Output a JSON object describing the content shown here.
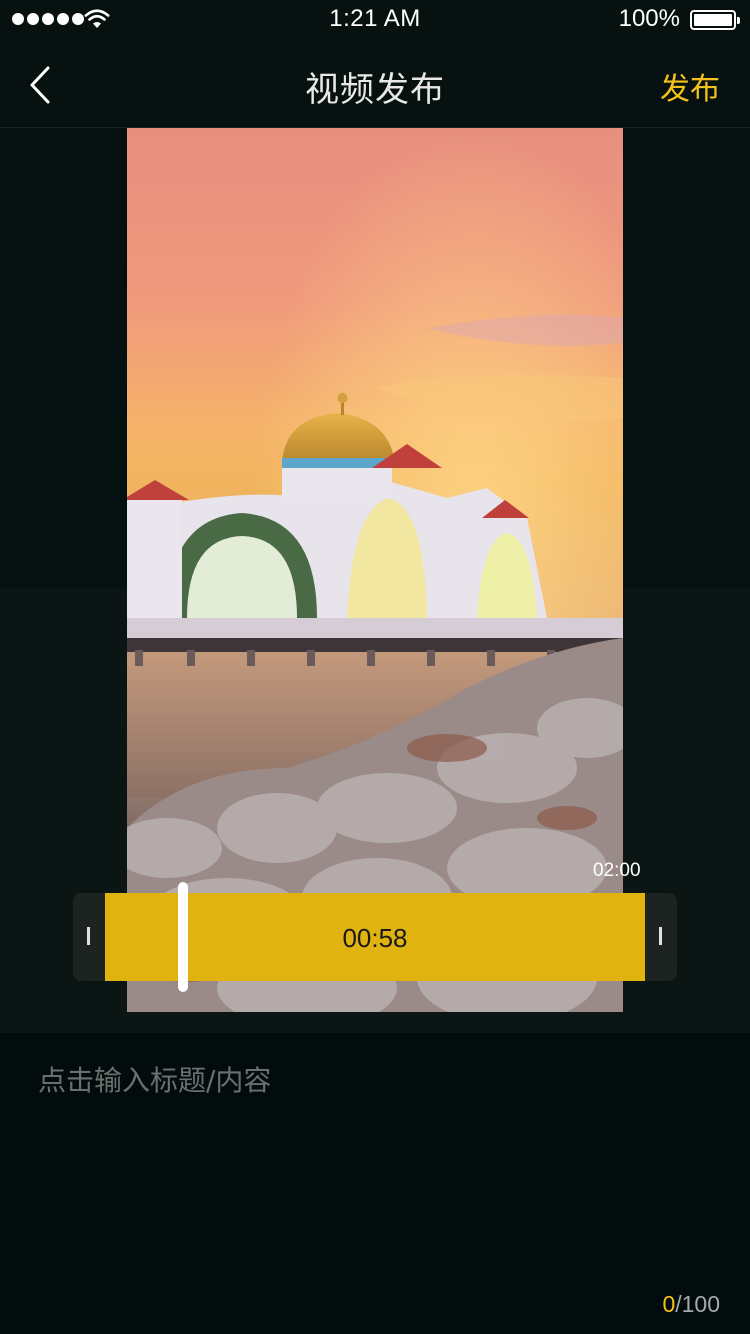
{
  "status_bar": {
    "time": "1:21 AM",
    "battery_percent": "100%",
    "icons": [
      "signal-dots-icon",
      "wifi-icon",
      "battery-icon"
    ]
  },
  "nav": {
    "title": "视频发布",
    "back_icon": "chevron-left-icon",
    "publish_label": "发布"
  },
  "video": {
    "total_duration": "02:00",
    "selected_duration": "00:58"
  },
  "content": {
    "placeholder": "点击输入标题/内容",
    "value": "",
    "current_count": "0",
    "max_count": "/100"
  },
  "colors": {
    "accent": "#f5c21b",
    "background": "#020c0c",
    "trim_selection": "#f2c010"
  }
}
